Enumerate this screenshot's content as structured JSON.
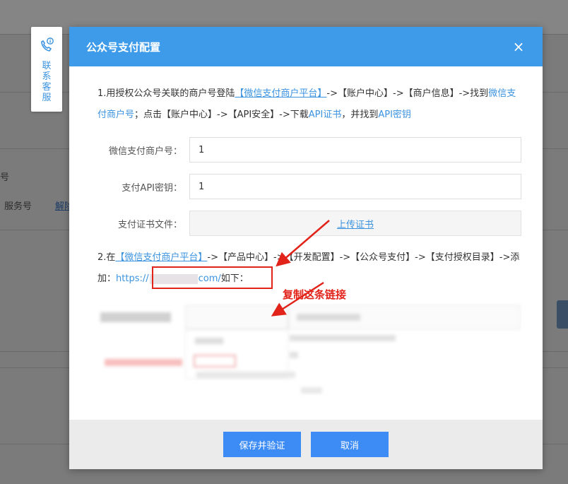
{
  "background": {
    "fragment_hao": "号",
    "fragment_service": "服务号",
    "fragment_link": "解除"
  },
  "contact": {
    "label": "联系客服",
    "icon": "phone-info-icon"
  },
  "modal": {
    "title": "公众号支付配置",
    "close_label": "×",
    "step1": {
      "prefix": "1.用授权公众号关联的商户号登陆",
      "link_platform": "【微信支付商户平台】",
      "mid1": "->【账户中心】->【商户信息】->找到",
      "link_merchant_no": "微信支付商户号",
      "mid2": "；点击【账户中心】->【API安全】->下载",
      "link_cert": "API证书",
      "mid3": "，并找到",
      "link_key": "API密钥"
    },
    "fields": {
      "merchant_no_label": "微信支付商户号：",
      "merchant_no_value": "1",
      "api_key_label": "支付API密钥：",
      "api_key_value": "1",
      "cert_label": "支付证书文件：",
      "upload_label": "上传证书"
    },
    "step2": {
      "prefix": "2.在",
      "link_platform": "【微信支付商户平台】",
      "mid1": "->【产品中心】->【开发配置】->【公众号支付】->【支付授权目录】->添加：",
      "url_start": "https://",
      "url_end": "com/",
      "suffix": "如下："
    },
    "annotation": "复制这条链接",
    "buttons": {
      "save": "保存并验证",
      "cancel": "取消"
    }
  },
  "colors": {
    "header": "#3d9be9",
    "button": "#3d8cf5",
    "link": "#3b93e0",
    "annotation": "#e2231a"
  }
}
